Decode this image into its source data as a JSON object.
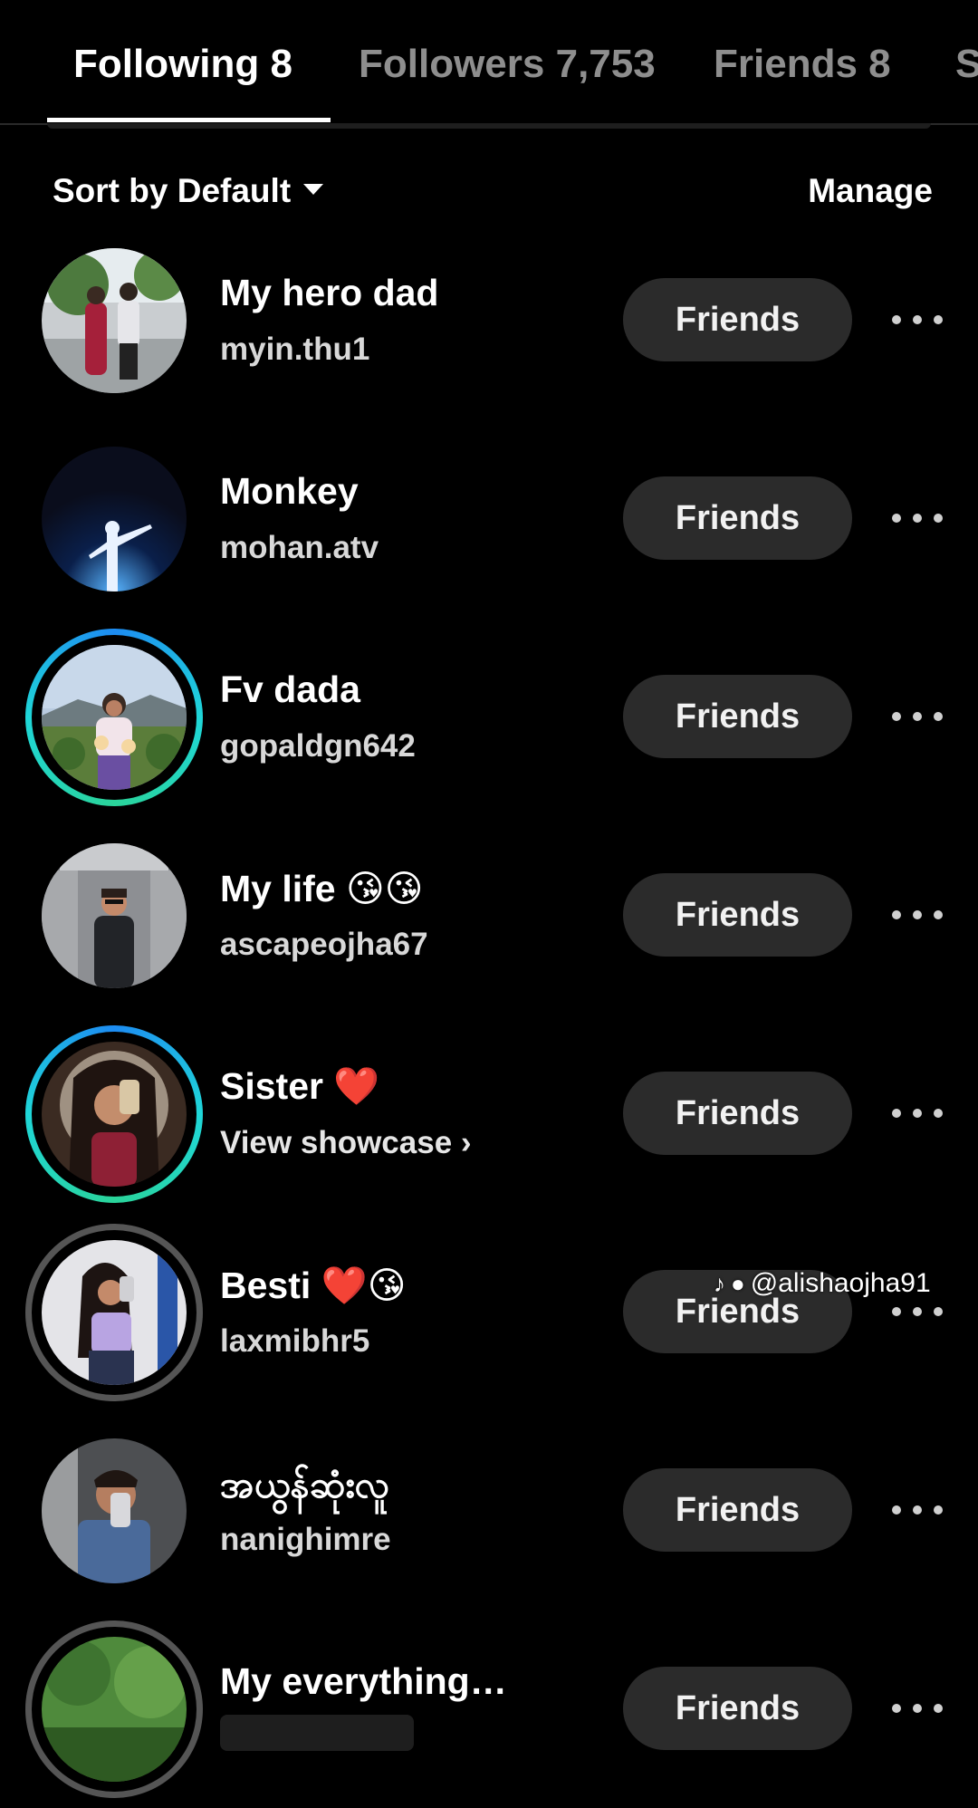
{
  "tabs": [
    {
      "label": "Following 8",
      "active": true
    },
    {
      "label": "Followers 7,753",
      "active": false
    },
    {
      "label": "Friends 8",
      "active": false
    },
    {
      "label": "S",
      "active": false
    }
  ],
  "sort": {
    "label": "Sort by Default",
    "icon": "caret-down-icon"
  },
  "manage_label": "Manage",
  "list": [
    {
      "name": "My hero dad",
      "sub": "myin.thu1",
      "button": "Friends",
      "ring": "none"
    },
    {
      "name": "Monkey",
      "sub": "mohan.atv",
      "button": "Friends",
      "ring": "none"
    },
    {
      "name": "Fv dada",
      "sub": "gopaldgn642",
      "button": "Friends",
      "ring": "story"
    },
    {
      "name": "My life 😘😘",
      "sub": "ascapeojha67",
      "button": "Friends",
      "ring": "none"
    },
    {
      "name": "Sister ❤️",
      "sub": "View showcase ›",
      "button": "Friends",
      "ring": "story"
    },
    {
      "name": "Besti ❤️😘",
      "sub": "laxmibhr5",
      "button": "Friends",
      "ring": "seen"
    },
    {
      "name": "အယွန်ဆုံးလူ",
      "sub": "nanighimre",
      "button": "Friends",
      "ring": "none"
    },
    {
      "name": "My everything…",
      "sub": "",
      "button": "Friends",
      "ring": "seen"
    }
  ],
  "watermark": {
    "text": "@alishaojha91",
    "icons": [
      "tiktok-icon",
      "person-icon"
    ]
  },
  "colors": {
    "background": "#000000",
    "button_bg": "#2b2b2b",
    "inactive_tab": "#8e8e8e",
    "story_ring": "#1fd6d8"
  }
}
